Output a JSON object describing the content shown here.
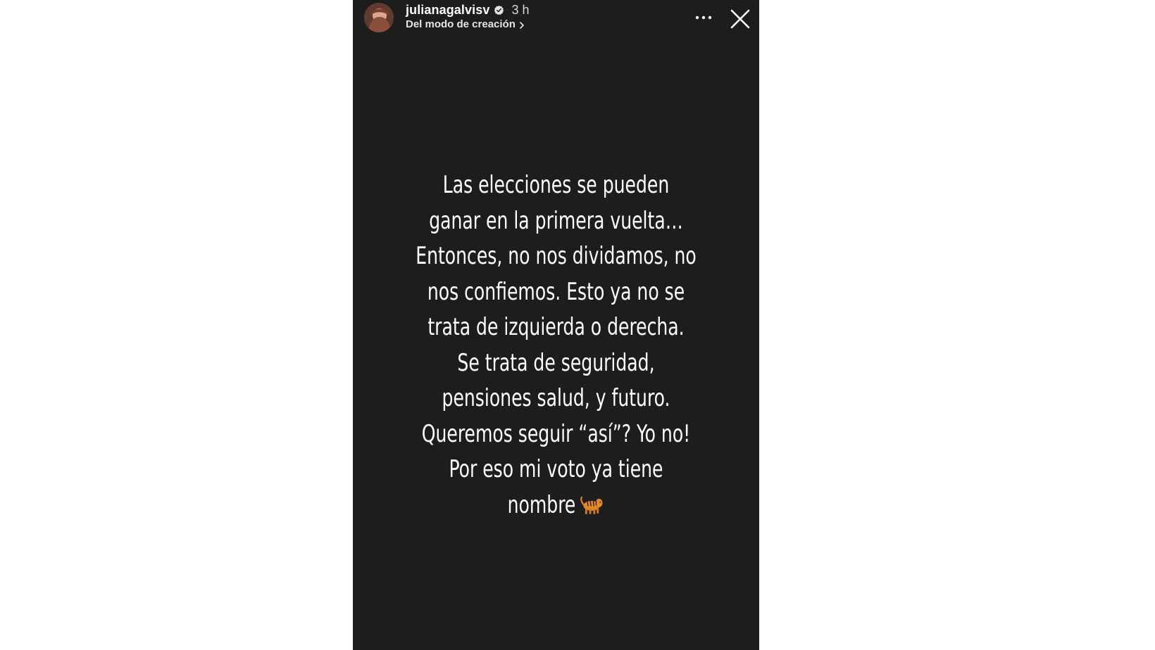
{
  "story": {
    "username": "julianagalvisv",
    "timestamp": "3 h",
    "source_label": "Del modo de creación",
    "icons": {
      "verified": "verified-badge-icon",
      "source_chevron": "chevron-right-icon",
      "more": "more-options-icon",
      "close": "close-icon",
      "emoji": "tiger-icon"
    },
    "text_lines": [
      "Las elecciones se pueden",
      "ganar en la primera vuelta…",
      "Entonces, no nos dividamos, no",
      "nos confiemos. Esto ya no se",
      "trata de izquierda o derecha.",
      "Se trata de seguridad,",
      "pensiones salud, y futuro.",
      "Queremos seguir “así”? Yo no!",
      "Por eso mi voto ya tiene",
      "nombre"
    ],
    "colors": {
      "background": "#1d1d1d",
      "text": "#ffffff",
      "page": "#ffffff"
    }
  }
}
